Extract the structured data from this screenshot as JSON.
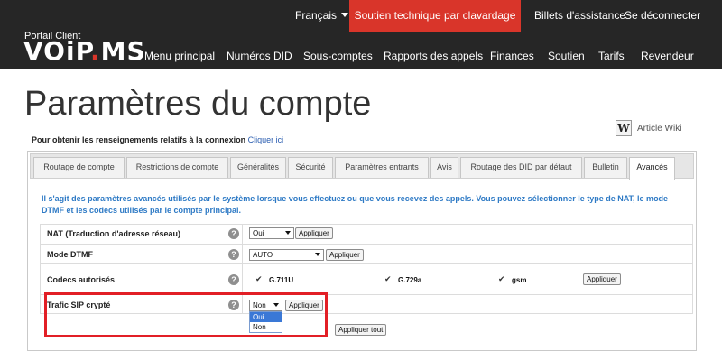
{
  "topbar": {
    "language": "Français",
    "support_chat": "Soutien technique par clavardage",
    "tickets": "Billets d'assistance",
    "logout": "Se déconnecter"
  },
  "logo": {
    "subtitle": "Portail Client",
    "name_left": "VOiP",
    "name_dot": ".",
    "name_right": "MS"
  },
  "nav": {
    "items": [
      "Menu principal",
      "Numéros DID",
      "Sous-comptes",
      "Rapports des appels",
      "Finances",
      "Soutien",
      "Tarifs",
      "Revendeur"
    ]
  },
  "page": {
    "title": "Paramètres du compte",
    "wiki_icon": "W",
    "wiki_label": "Article Wiki",
    "conn_info": "Pour obtenir les renseignements relatifs à la connexion",
    "conn_link": "Cliquer ici"
  },
  "tabs": [
    "Routage de compte",
    "Restrictions de compte",
    "Généralités",
    "Sécurité",
    "Paramètres entrants",
    "Avis",
    "Routage des DID par défaut",
    "Bulletin",
    "Avancés"
  ],
  "intro": "Il s'agit des paramètres avancés utilisés par le système lorsque vous effectuez ou que vous recevez des appels. Vous pouvez sélectionner le type de NAT, le mode DTMF et les codecs utilisés par le compte principal.",
  "settings": {
    "help_glyph": "?",
    "apply_label": "Appliquer",
    "apply_all_label": "Appliquer tout",
    "nat": {
      "label": "NAT (Traduction d'adresse réseau)",
      "value": "Oui"
    },
    "dtmf": {
      "label": "Mode DTMF",
      "value": "AUTO"
    },
    "codecs": {
      "label": "Codecs autorisés",
      "check_glyph": "✔",
      "items": [
        {
          "name": "G.711U",
          "checked": true
        },
        {
          "name": "G.729a",
          "checked": true
        },
        {
          "name": "gsm",
          "checked": true
        }
      ]
    },
    "sip": {
      "label": "Trafic SIP crypté",
      "value": "Non",
      "options": [
        "Oui",
        "Non"
      ],
      "highlighted_option": "Oui"
    }
  },
  "colors": {
    "header_bg": "#262626",
    "accent_red": "#d9352a",
    "intro_blue": "#2e7ac5",
    "highlight_box": "#e21f26"
  }
}
